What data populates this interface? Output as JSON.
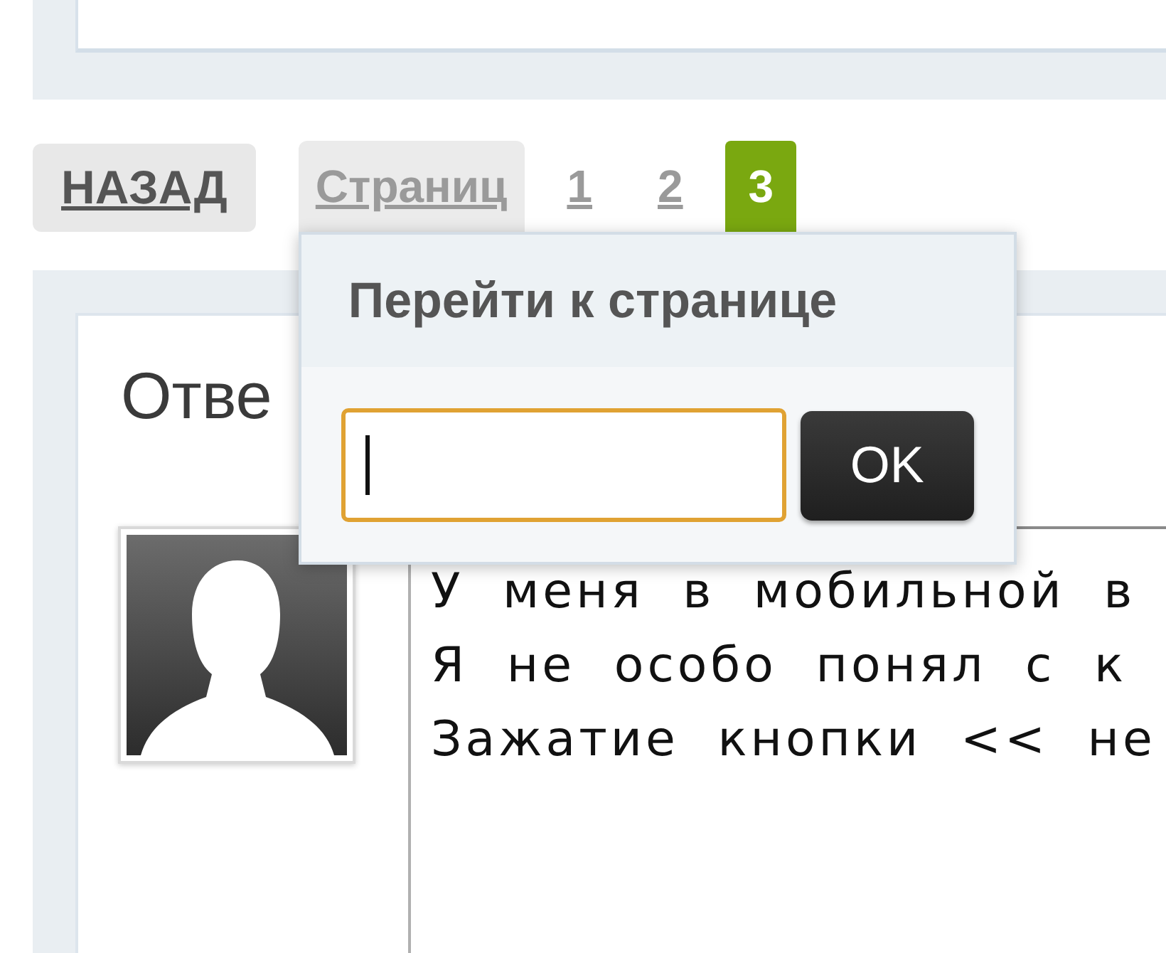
{
  "pagination": {
    "back_button": {
      "label": "НАЗАД"
    },
    "page_jump": {
      "label": "Страниц",
      "expanded": true,
      "popup": {
        "title": "Перейти к странице",
        "page_field": {
          "focused": true
        },
        "ok_button": {
          "label": "OK"
        }
      }
    },
    "pages": [
      {
        "label": "1",
        "selected": false
      },
      {
        "label": "2",
        "selected": false
      },
      {
        "label": "3",
        "selected": true
      }
    ]
  },
  "post_section": {
    "heading": "Отве",
    "post": {
      "lines": [
        "У меня в мобильной в",
        "Я не особо понял с к",
        "Зажатие кнопки << не"
      ]
    }
  }
}
